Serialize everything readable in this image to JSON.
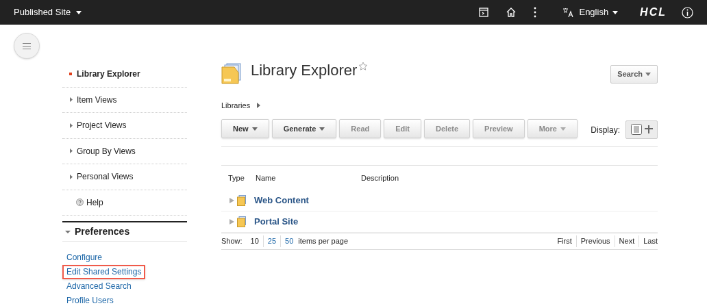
{
  "topbar": {
    "site": "Published Site",
    "language": "English",
    "brand": "HCL"
  },
  "nav": [
    {
      "label": "Library Explorer",
      "kind": "view",
      "selected": true
    },
    {
      "label": "Item Views",
      "kind": "view",
      "selected": false
    },
    {
      "label": "Project Views",
      "kind": "view",
      "selected": false
    },
    {
      "label": "Group By Views",
      "kind": "view",
      "selected": false
    },
    {
      "label": "Personal Views",
      "kind": "view",
      "selected": false
    },
    {
      "label": "Help",
      "kind": "help",
      "selected": false
    }
  ],
  "preferences": {
    "title": "Preferences",
    "expanded": true,
    "links": [
      {
        "label": "Configure",
        "highlighted": false
      },
      {
        "label": "Edit Shared Settings",
        "highlighted": true
      },
      {
        "label": "Advanced Search",
        "highlighted": false
      },
      {
        "label": "Profile Users",
        "highlighted": false
      }
    ]
  },
  "page": {
    "title": "Library Explorer",
    "search": "Search",
    "breadcrumb": "Libraries"
  },
  "toolbar": [
    {
      "label": "New",
      "menu": true,
      "disabled": false
    },
    {
      "label": "Generate",
      "menu": true,
      "disabled": false
    },
    {
      "label": "Read",
      "menu": false,
      "disabled": true
    },
    {
      "label": "Edit",
      "menu": false,
      "disabled": true
    },
    {
      "label": "Delete",
      "menu": false,
      "disabled": true
    },
    {
      "label": "Preview",
      "menu": false,
      "disabled": true
    },
    {
      "label": "More",
      "menu": true,
      "disabled": true
    }
  ],
  "display": {
    "label": "Display:",
    "list_selected": true
  },
  "table": {
    "columns": [
      "Type",
      "Name",
      "Description"
    ],
    "rows": [
      {
        "name": "Web Content"
      },
      {
        "name": "Portal Site"
      }
    ]
  },
  "pager": {
    "show": "Show:",
    "sizes": [
      {
        "label": "10",
        "selected": true
      },
      {
        "label": "25",
        "selected": false
      },
      {
        "label": "50",
        "selected": false
      }
    ],
    "suffix": "items per page",
    "nav": [
      "First",
      "Previous",
      "Next",
      "Last"
    ]
  }
}
